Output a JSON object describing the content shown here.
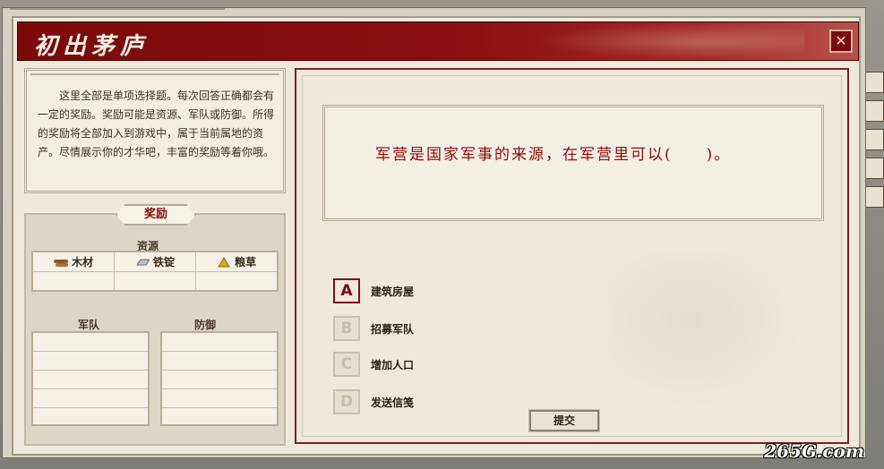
{
  "dialog": {
    "title": "初出茅庐",
    "close_label": "✕"
  },
  "intro": {
    "text": "这里全部是单项选择题。每次回答正确都会有一定的奖励。奖励可能是资源、军队或防御。所得的奖励将全部加入到游戏中，属于当前属地的资产。尽情展示你的才华吧，丰富的奖励等着你哦。"
  },
  "reward": {
    "header": "奖励",
    "resources_label": "资源",
    "resources": [
      {
        "name": "木材",
        "icon": "wood-icon"
      },
      {
        "name": "铁锭",
        "icon": "iron-icon"
      },
      {
        "name": "粮草",
        "icon": "grain-icon"
      }
    ],
    "army_label": "军队",
    "defense_label": "防御"
  },
  "question": {
    "text": "军营是国家军事的来源，在军营里可以(　　)。"
  },
  "options": [
    {
      "letter": "A",
      "label": "建筑房屋",
      "active": true
    },
    {
      "letter": "B",
      "label": "招募军队",
      "active": false
    },
    {
      "letter": "C",
      "label": "增加人口",
      "active": false
    },
    {
      "letter": "D",
      "label": "发送信笺",
      "active": false
    }
  ],
  "submit_label": "提交",
  "watermark": "265G.com",
  "colors": {
    "title_red": "#8c0f12",
    "question_red": "#8c0a0a"
  }
}
